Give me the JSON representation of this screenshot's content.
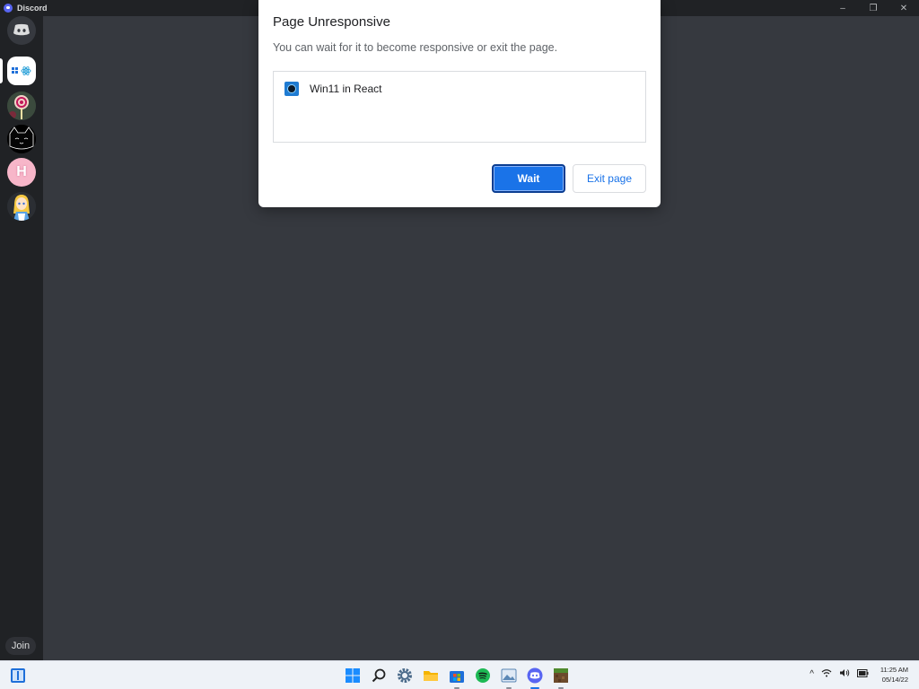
{
  "window": {
    "title": "Discord",
    "controls": {
      "minimize": "–",
      "maximize": "❐",
      "close": "✕"
    }
  },
  "rail": {
    "home_icon": "discord-logo",
    "servers": [
      {
        "name": "win11-react-server",
        "icon": "win11-react"
      },
      {
        "name": "lollipop-server",
        "icon": "lollipop"
      },
      {
        "name": "black-cat-server",
        "icon": "black-cat"
      },
      {
        "name": "pink-h-server",
        "icon": "pink-h-letter",
        "letter": "H"
      },
      {
        "name": "alice-server",
        "icon": "alice-avatar"
      }
    ],
    "join_label": "Join"
  },
  "dialog": {
    "title": "Page Unresponsive",
    "message": "You can wait for it to become responsive or exit the page.",
    "pages": [
      {
        "name": "Win11 in React",
        "icon": "react-favicon"
      }
    ],
    "wait_label": "Wait",
    "exit_label": "Exit page",
    "accent": "#1a73e8"
  },
  "taskbar": {
    "left_icon": "widgets-icon",
    "apps": [
      {
        "name": "start",
        "icon": "windows-logo",
        "running": false
      },
      {
        "name": "search",
        "icon": "search-icon",
        "running": false
      },
      {
        "name": "settings",
        "icon": "gear-icon",
        "running": false
      },
      {
        "name": "file-explorer",
        "icon": "folder-icon",
        "running": false
      },
      {
        "name": "store",
        "icon": "store-icon",
        "running": true
      },
      {
        "name": "spotify",
        "icon": "spotify-icon",
        "running": false
      },
      {
        "name": "photos",
        "icon": "photos-icon",
        "running": true
      },
      {
        "name": "discord",
        "icon": "discord-icon",
        "running": true,
        "active": true
      },
      {
        "name": "minecraft",
        "icon": "minecraft-icon",
        "running": true
      }
    ],
    "tray": {
      "chevron": "^",
      "wifi": "wifi-icon",
      "volume": "volume-icon",
      "battery": "battery-icon"
    },
    "clock": {
      "time": "11:25 AM",
      "date": "05/14/22"
    }
  }
}
